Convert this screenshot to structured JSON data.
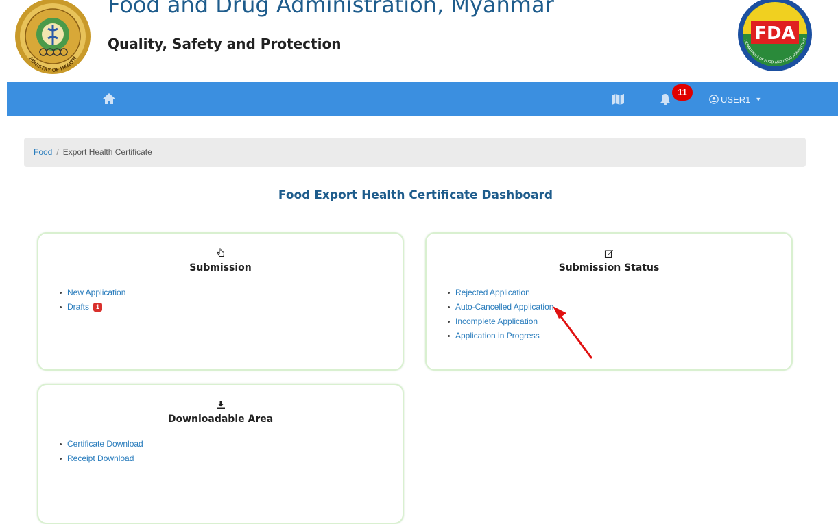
{
  "header": {
    "title": "Food and Drug Administration, Myanmar",
    "tagline": "Quality, Safety and Protection",
    "left_logo_text": "MINISTRY OF HEALTH AND SPORTS",
    "right_logo_text": "FDA",
    "right_logo_ring_text": "DEPARTMENT OF FOOD AND DRUG ADMINISTRATION"
  },
  "navbar": {
    "home_icon": "home-icon",
    "map_icon": "map-icon",
    "bell_icon": "bell-icon",
    "notification_count": "11",
    "user_label": "USER1",
    "user_icon": "user-circle-icon",
    "caret_icon": "caret-down-icon",
    "color": "#3b8fe0"
  },
  "breadcrumb": {
    "items": [
      "Food",
      "Export Health Certificate"
    ],
    "separator": "/"
  },
  "page_title": "Food Export Health Certificate Dashboard",
  "cards": {
    "submission": {
      "icon": "hand-pointer-icon",
      "title": "Submission",
      "items": [
        "New Application",
        "Drafts"
      ],
      "drafts_badge": "1"
    },
    "status": {
      "icon": "edit-icon",
      "title": "Submission Status",
      "items": [
        "Rejected Application",
        "Auto-Cancelled Application",
        "Incomplete Application",
        "Application in Progress"
      ]
    },
    "download": {
      "icon": "download-icon",
      "title": "Downloadable Area",
      "items": [
        "Certificate Download",
        "Receipt Download"
      ]
    }
  },
  "colors": {
    "link": "#2a7dbd",
    "title_blue": "#1e5c8c",
    "badge_red": "#e00000",
    "card_border": "#d9f0d0",
    "annotation_arrow": "#e01010"
  }
}
